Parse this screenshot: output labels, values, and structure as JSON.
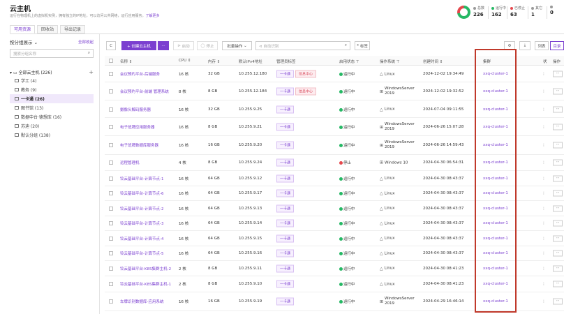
{
  "page": {
    "title": "云主机",
    "desc": "运行在物理机上的虚拟机实例，拥有独立的IP地址，可以访问公共网络，运行应用服务。",
    "desc_link": "了解更多"
  },
  "stats": [
    {
      "label": "总数",
      "value": "226",
      "color": "#999999"
    },
    {
      "label": "运行中",
      "value": "162",
      "color": "#25b864"
    },
    {
      "label": "已停止",
      "value": "63",
      "color": "#e5484d"
    },
    {
      "label": "其它",
      "value": "1",
      "color": "#999999"
    },
    {
      "label": "",
      "value": "0",
      "color": "#999999"
    }
  ],
  "tabs": [
    "可用资源",
    "回收站",
    "导出记录"
  ],
  "sidebar": {
    "title": "按分组展示",
    "all": "全部收起",
    "search_placeholder": "搜索分组名称",
    "root": "全部云主机 (226)",
    "items": [
      "学工 (4)",
      "教务 (9)",
      "一卡通 (26)",
      "图书馆 (13)",
      "数据中台·德想库 (16)",
      "苏迪 (20)",
      "默认分组 (138)"
    ]
  },
  "toolbar": {
    "refresh": "C",
    "create": "+ 创建云主机",
    "more": "···",
    "start": "启动",
    "stop": "停止",
    "batch": "批量操作",
    "search_placeholder": "自动识别",
    "tag": "标签",
    "settings": "⚙",
    "download": "⤓",
    "list": "列表",
    "dir": "目录"
  },
  "columns": [
    "名称",
    "CPU",
    "内存",
    "默认IPv4地址",
    "管理员标签",
    "启用状态",
    "操作系统",
    "创建时间",
    "集群",
    "状",
    "操作"
  ],
  "rows": [
    {
      "name": "会议预约平台-后端服务",
      "cpu": "16 核",
      "mem": "32 GB",
      "ip": "10.255.12.180",
      "tags": [
        "一卡通",
        "信息中心"
      ],
      "status": "运行中",
      "os": "Linux",
      "time": "2024-12-02 19:34:49",
      "cluster": "xxq-cluster-1"
    },
    {
      "name": "会议预约平台-前端 管理系统",
      "cpu": "8 核",
      "mem": "8 GB",
      "ip": "10.255.12.184",
      "tags": [
        "一卡通",
        "信息中心"
      ],
      "status": "运行中",
      "os": "WindowsServer 2019",
      "time": "2024-12-02 19:32:52",
      "cluster": "xxq-cluster-1"
    },
    {
      "name": "摄像头解码服务器",
      "cpu": "16 核",
      "mem": "32 GB",
      "ip": "10.255.9.25",
      "tags": [
        "一卡通"
      ],
      "status": "运行中",
      "os": "Linux",
      "time": "2024-07-04 09:11:55",
      "cluster": "xxq-cluster-1"
    },
    {
      "name": "电子班牌应用服务器",
      "cpu": "16 核",
      "mem": "8 GB",
      "ip": "10.255.9.21",
      "tags": [
        "一卡通"
      ],
      "status": "运行中",
      "os": "WindowsServer 2019",
      "time": "2024-06-26 15:07:28",
      "cluster": "xxq-cluster-1"
    },
    {
      "name": "电子班牌数据库服务器",
      "cpu": "16 核",
      "mem": "16 GB",
      "ip": "10.255.9.20",
      "tags": [
        "一卡通"
      ],
      "status": "运行中",
      "os": "WindowsServer 2019",
      "time": "2024-06-26 14:59:43",
      "cluster": "xxq-cluster-1"
    },
    {
      "name": "远程管理机",
      "cpu": "4 核",
      "mem": "8 GB",
      "ip": "10.255.9.24",
      "tags": [
        "一卡通"
      ],
      "status": "停止",
      "os": "Windows 10",
      "time": "2024-04-30 06:54:31",
      "cluster": "xxq-cluster-1"
    },
    {
      "name": "铃云基础平台-计算节点-1",
      "cpu": "16 核",
      "mem": "64 GB",
      "ip": "10.255.9.12",
      "tags": [
        "一卡通"
      ],
      "status": "运行中",
      "os": "Linux",
      "time": "2024-04-30 08:43:37",
      "cluster": "xxq-cluster-1"
    },
    {
      "name": "铃云基础平台-计算节点-6",
      "cpu": "16 核",
      "mem": "64 GB",
      "ip": "10.255.9.17",
      "tags": [
        "一卡通"
      ],
      "status": "运行中",
      "os": "Linux",
      "time": "2024-04-30 08:43:37",
      "cluster": "xxq-cluster-1"
    },
    {
      "name": "铃云基础平台-计算节点-2",
      "cpu": "16 核",
      "mem": "64 GB",
      "ip": "10.255.9.13",
      "tags": [
        "一卡通"
      ],
      "status": "运行中",
      "os": "Linux",
      "time": "2024-04-30 08:43:37",
      "cluster": "xxq-cluster-1"
    },
    {
      "name": "铃云基础平台-计算节点-3",
      "cpu": "16 核",
      "mem": "64 GB",
      "ip": "10.255.9.14",
      "tags": [
        "一卡通"
      ],
      "status": "运行中",
      "os": "Linux",
      "time": "2024-04-30 08:43:37",
      "cluster": "xxq-cluster-1"
    },
    {
      "name": "铃云基础平台-计算节点-4",
      "cpu": "16 核",
      "mem": "64 GB",
      "ip": "10.255.9.15",
      "tags": [
        "一卡通"
      ],
      "status": "运行中",
      "os": "Linux",
      "time": "2024-04-30 08:43:37",
      "cluster": "xxq-cluster-1"
    },
    {
      "name": "铃云基础平台-计算节点-5",
      "cpu": "16 核",
      "mem": "64 GB",
      "ip": "10.255.9.16",
      "tags": [
        "一卡通"
      ],
      "status": "运行中",
      "os": "Linux",
      "time": "2024-04-30 08:43:37",
      "cluster": "xxq-cluster-1"
    },
    {
      "name": "铃云基础平台-K8S集群主机-2",
      "cpu": "2 核",
      "mem": "8 GB",
      "ip": "10.255.9.11",
      "tags": [
        "一卡通"
      ],
      "status": "运行中",
      "os": "Linux",
      "time": "2024-04-30 08:41:23",
      "cluster": "xxq-cluster-1"
    },
    {
      "name": "铃云基础平台-K8S集群主机-1",
      "cpu": "2 核",
      "mem": "8 GB",
      "ip": "10.255.9.10",
      "tags": [
        "一卡通"
      ],
      "status": "运行中",
      "os": "Linux",
      "time": "2024-04-30 08:41:23",
      "cluster": "xxq-cluster-1"
    },
    {
      "name": "车牌识别数据库-应用系统",
      "cpu": "16 核",
      "mem": "16 GB",
      "ip": "10.255.9.19",
      "tags": [
        "一卡通"
      ],
      "status": "运行中",
      "os": "WindowsServer 2019",
      "time": "2024-04-29 16:46:14",
      "cluster": "xxq-cluster-1"
    }
  ],
  "status_colors": {
    "运行中": "#25b864",
    "停止": "#e5484d"
  },
  "highlight_color": "#c0392b"
}
